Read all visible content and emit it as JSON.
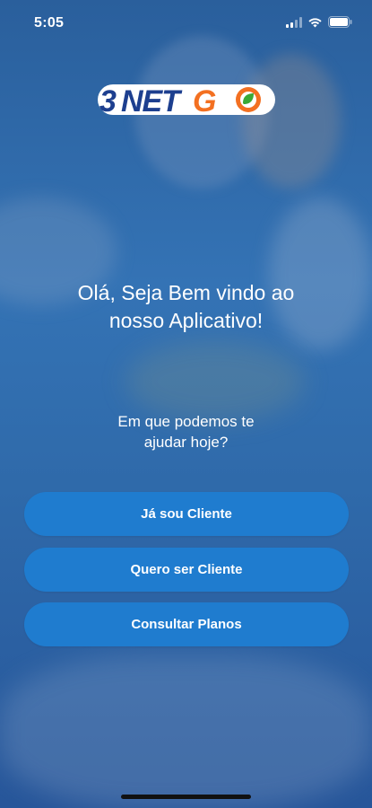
{
  "status_bar": {
    "time": "5:05"
  },
  "brand": {
    "logo_text": "NETGO",
    "logo_prefix": "NET",
    "logo_suffix": "GO",
    "accent": "#f37021",
    "brand_blue": "#1d3f8f"
  },
  "welcome": {
    "line1": "Olá, Seja Bem vindo ao",
    "line2": "nosso Aplicativo!"
  },
  "help": {
    "line1": "Em que podemos te",
    "line2": "ajudar hoje?"
  },
  "buttons": {
    "client": "Já sou Cliente",
    "become_client": "Quero ser Cliente",
    "plans": "Consultar Planos"
  },
  "colors": {
    "button": "#1f7ccf",
    "background": "#3473b5"
  },
  "icons": [
    "signal-icon",
    "wifi-icon",
    "battery-icon",
    "leaf-icon"
  ]
}
